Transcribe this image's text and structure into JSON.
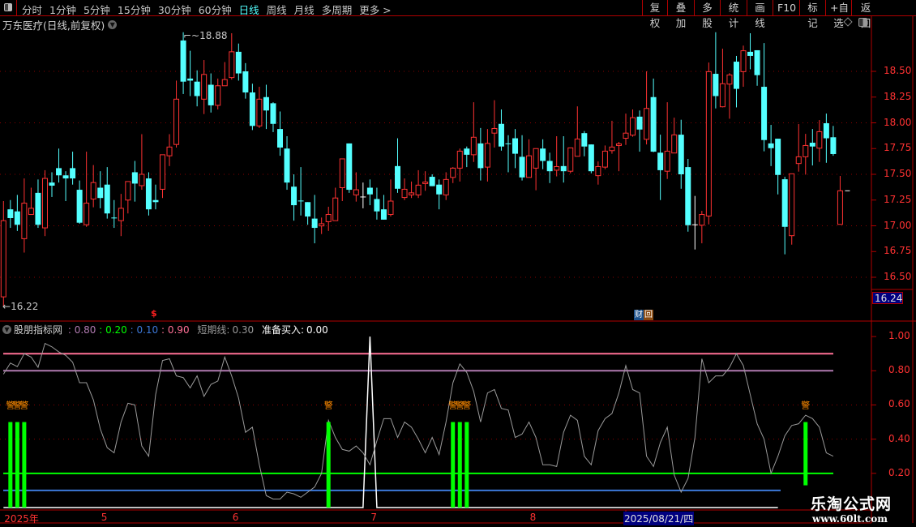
{
  "toolbar": {
    "periods": [
      "分时",
      "1分钟",
      "5分钟",
      "15分钟",
      "30分钟",
      "60分钟",
      "日线",
      "周线",
      "月线",
      "多周期",
      "更多 >"
    ],
    "active_period": "日线",
    "right_buttons": [
      "复权",
      "叠加",
      "多股",
      "统计",
      "画线",
      "F10",
      "标记",
      "+自选",
      "返回"
    ]
  },
  "chart_title": "万东医疗(日线,前复权)",
  "price_axis": [
    "18.50",
    "18.25",
    "18.00",
    "17.75",
    "17.50",
    "17.25",
    "17.00",
    "16.75",
    "16.50"
  ],
  "current_price_badge": "16.24",
  "high_label": "18.88",
  "low_label": "16.22",
  "markers": {
    "dollar": "$",
    "cai": "财",
    "hui": "回"
  },
  "indicator": {
    "name": "股朋指标网",
    "params": [
      {
        "sep": " : ",
        "value": "0.80",
        "color": "#b07ab0"
      },
      {
        "sep": " : ",
        "value": "0.20",
        "color": "#00ff00"
      },
      {
        "sep": " : ",
        "value": "0.10",
        "color": "#3c78d8"
      },
      {
        "sep": " : ",
        "value": "0.90",
        "color": "#ff7096"
      }
    ],
    "short_line_label": "短期线:",
    "short_line_value": "0.30",
    "buy_label": "准备买入:",
    "buy_value": "0.00",
    "axis": [
      "1.00",
      "0.80",
      "0.60",
      "0.40",
      "0.20"
    ],
    "signal_char": "警"
  },
  "time_axis": {
    "labels": [
      "2025年",
      "5",
      "6",
      "7",
      "8"
    ],
    "cursor_date": "2025/08/21/四"
  },
  "watermark": {
    "title": "乐淘公式网",
    "url": "www.60lt.com"
  },
  "colors": {
    "up": "#ff3232",
    "down": "#54ffff",
    "flat": "#ffffff",
    "accent": "#b00000"
  },
  "chart_data": {
    "type": "candlestick",
    "price_range": [
      16.22,
      18.88
    ],
    "ohlc": [
      [
        16.31,
        17.24,
        16.22,
        17.05
      ],
      [
        17.16,
        17.25,
        16.98,
        17.075
      ],
      [
        17.14,
        17.3,
        16.95,
        17.01
      ],
      [
        16.875,
        17.46,
        16.74,
        17.22
      ],
      [
        17.11,
        17.37,
        17.11,
        17.17
      ],
      [
        17.32,
        17.45,
        16.98,
        17.01
      ],
      [
        16.98,
        17.54,
        16.9,
        17.46
      ],
      [
        17.42,
        17.52,
        17.28,
        17.39
      ],
      [
        17.56,
        17.75,
        17.42,
        17.49
      ],
      [
        17.49,
        17.53,
        17.24,
        17.46
      ],
      [
        17.56,
        17.72,
        17.4,
        17.46
      ],
      [
        17.35,
        17.44,
        17.02,
        17.03
      ],
      [
        17.01,
        17.72,
        16.99,
        17.22
      ],
      [
        17.26,
        17.59,
        17.18,
        17.42
      ],
      [
        17.37,
        17.53,
        17.17,
        17.27
      ],
      [
        17.4,
        17.57,
        17.07,
        17.12
      ],
      [
        17.08,
        17.25,
        16.98,
        17.079
      ],
      [
        17.05,
        17.31,
        16.9,
        17.17
      ],
      [
        17.25,
        17.43,
        17.12,
        17.43
      ],
      [
        17.52,
        17.63,
        17.235,
        17.41
      ],
      [
        17.39,
        17.89,
        17.35,
        17.5
      ],
      [
        17.46,
        17.52,
        17.1,
        17.16
      ],
      [
        17.25,
        17.4,
        17.16,
        17.23
      ],
      [
        17.355,
        17.69,
        17.27,
        17.69
      ],
      [
        17.68,
        17.89,
        17.58,
        17.765
      ],
      [
        17.79,
        18.41,
        17.76,
        18.23
      ],
      [
        18.8,
        18.88,
        18.28,
        18.4
      ],
      [
        18.43,
        18.7,
        18.26,
        18.41
      ],
      [
        18.4,
        18.51,
        18.16,
        18.26
      ],
      [
        18.23,
        18.61,
        18.085,
        18.47
      ],
      [
        18.37,
        18.48,
        18.1,
        18.17
      ],
      [
        18.17,
        18.43,
        18.13,
        18.36
      ],
      [
        18.36,
        18.59,
        18.36,
        18.42
      ],
      [
        18.44,
        18.87,
        18.42,
        18.69
      ],
      [
        18.69,
        18.77,
        18.41,
        18.48
      ],
      [
        18.5,
        18.58,
        18.235,
        18.295
      ],
      [
        18.295,
        18.38,
        17.93,
        17.97
      ],
      [
        17.97,
        18.35,
        17.95,
        18.23
      ],
      [
        18.25,
        18.37,
        17.94,
        18.12
      ],
      [
        18.19,
        18.2,
        17.91,
        17.99
      ],
      [
        17.94,
        18.11,
        17.68,
        17.76
      ],
      [
        17.75,
        17.87,
        17.35,
        17.42
      ],
      [
        17.38,
        17.5,
        17.05,
        17.2
      ],
      [
        17.245,
        17.57,
        17.1,
        17.24
      ],
      [
        17.23,
        17.23,
        17.01,
        17.09
      ],
      [
        17.07,
        17.3,
        16.83,
        16.98
      ],
      [
        16.999,
        17.08,
        16.92,
        17.02
      ],
      [
        17.04,
        17.185,
        16.95,
        17.11
      ],
      [
        17.05,
        17.37,
        17.05,
        17.27
      ],
      [
        17.37,
        17.65,
        17.24,
        17.65
      ],
      [
        17.8,
        17.8,
        17.32,
        17.35
      ],
      [
        17.3,
        17.52,
        17.235,
        17.35
      ],
      [
        17.28,
        17.42,
        17.17,
        17.28
      ],
      [
        17.37,
        17.45,
        17.2,
        17.305
      ],
      [
        17.26,
        17.37,
        17.06,
        17.14
      ],
      [
        17.16,
        17.3,
        17.06,
        17.06
      ],
      [
        17.11,
        17.45,
        17.09,
        17.24
      ],
      [
        17.58,
        17.85,
        17.32,
        17.36
      ],
      [
        17.275,
        17.46,
        17.25,
        17.355
      ],
      [
        17.3,
        17.43,
        17.27,
        17.32
      ],
      [
        17.3,
        17.54,
        17.27,
        17.395
      ],
      [
        17.41,
        17.53,
        17.34,
        17.425
      ],
      [
        17.476,
        17.5,
        17.385,
        17.385
      ],
      [
        17.4,
        17.45,
        17.16,
        17.305
      ],
      [
        17.3,
        17.52,
        17.25,
        17.45
      ],
      [
        17.47,
        17.57,
        17.415,
        17.56
      ],
      [
        17.56,
        17.75,
        17.43,
        17.725
      ],
      [
        17.75,
        17.77,
        17.57,
        17.69
      ],
      [
        17.69,
        18.2,
        17.62,
        17.86
      ],
      [
        17.8,
        17.95,
        17.44,
        17.56
      ],
      [
        17.57,
        17.94,
        17.43,
        17.8
      ],
      [
        17.9,
        18.22,
        17.76,
        17.945
      ],
      [
        17.99,
        18.13,
        17.73,
        17.77
      ],
      [
        17.8,
        17.88,
        17.52,
        17.799
      ],
      [
        17.85,
        17.94,
        17.56,
        17.7
      ],
      [
        17.67,
        17.88,
        17.44,
        17.47
      ],
      [
        17.47,
        17.84,
        17.47,
        17.68
      ],
      [
        17.56,
        17.75,
        17.345,
        17.75
      ],
      [
        17.75,
        17.84,
        17.55,
        17.63
      ],
      [
        17.63,
        17.71,
        17.415,
        17.53
      ],
      [
        17.54,
        17.87,
        17.48,
        17.575
      ],
      [
        17.58,
        17.87,
        17.42,
        17.53
      ],
      [
        17.53,
        17.757,
        17.51,
        17.757
      ],
      [
        17.675,
        18.16,
        17.675,
        17.843
      ],
      [
        17.9,
        17.92,
        17.675,
        17.77
      ],
      [
        17.79,
        17.79,
        17.51,
        17.53
      ],
      [
        17.487,
        17.625,
        17.4,
        17.575
      ],
      [
        17.57,
        17.78,
        17.55,
        17.725
      ],
      [
        17.73,
        18.02,
        17.7,
        17.765
      ],
      [
        17.78,
        17.815,
        17.53,
        17.796
      ],
      [
        17.85,
        18.09,
        17.785,
        17.9
      ],
      [
        17.88,
        18.13,
        17.865,
        18.05
      ],
      [
        18.06,
        18.12,
        17.72,
        17.935
      ],
      [
        17.84,
        18.5,
        17.79,
        18.14
      ],
      [
        18.25,
        18.43,
        17.715,
        17.72
      ],
      [
        17.71,
        17.885,
        17.25,
        17.54
      ],
      [
        17.53,
        18.2,
        17.455,
        17.725
      ],
      [
        17.707,
        18.05,
        17.707,
        17.883
      ],
      [
        17.885,
        18.03,
        17.36,
        17.5
      ],
      [
        17.57,
        17.65,
        16.943,
        17.006
      ],
      [
        17.01,
        17.29,
        16.77,
        17.01
      ],
      [
        17.006,
        17.145,
        16.83,
        17.11
      ],
      [
        17.095,
        18.586,
        17.014,
        18.497
      ],
      [
        18.476,
        18.88,
        18.14,
        18.26
      ],
      [
        18.156,
        18.72,
        18.15,
        18.38
      ],
      [
        18.376,
        18.483,
        18.04,
        18.465
      ],
      [
        18.594,
        18.65,
        18.15,
        18.33
      ],
      [
        18.497,
        18.75,
        18.35,
        18.7
      ],
      [
        18.69,
        18.87,
        18.52,
        18.65
      ],
      [
        18.705,
        18.705,
        18.36,
        18.463
      ],
      [
        18.35,
        18.775,
        17.723,
        17.833
      ],
      [
        17.8,
        17.98,
        17.58,
        17.754
      ],
      [
        17.846,
        17.846,
        17.305,
        17.494
      ],
      [
        17.452,
        17.476,
        16.723,
        16.99
      ],
      [
        16.904,
        17.505,
        16.817,
        17.505
      ],
      [
        17.605,
        17.988,
        17.526,
        17.67
      ],
      [
        17.67,
        17.893,
        17.497,
        17.78
      ],
      [
        17.807,
        17.94,
        17.586,
        17.77
      ],
      [
        17.754,
        18.027,
        17.62,
        17.914
      ],
      [
        17.996,
        18.09,
        17.612,
        17.85
      ],
      [
        17.86,
        17.97,
        17.68,
        17.697
      ],
      [
        17.014,
        17.484,
        17.014,
        17.34
      ]
    ],
    "last_price_tick": 17.34,
    "indicator_range": [
      0,
      1
    ],
    "indicator_levels": [
      {
        "value": 0.9,
        "color": "#ff7096"
      },
      {
        "value": 0.8,
        "color": "#b07ab0"
      },
      {
        "value": 0.2,
        "color": "#00ff00"
      },
      {
        "value": 0.1,
        "color": "#3c78d8"
      }
    ],
    "short_line": [
      0.78,
      0.845,
      0.824,
      0.9,
      0.88,
      0.82,
      0.96,
      0.94,
      0.91,
      0.89,
      0.85,
      0.73,
      0.73,
      0.63,
      0.46,
      0.35,
      0.32,
      0.5,
      0.61,
      0.6,
      0.36,
      0.3,
      0.66,
      0.86,
      0.87,
      0.77,
      0.76,
      0.7,
      0.77,
      0.65,
      0.72,
      0.74,
      0.88,
      0.77,
      0.64,
      0.44,
      0.47,
      0.25,
      0.07,
      0.05,
      0.05,
      0.09,
      0.08,
      0.06,
      0.09,
      0.12,
      0.2,
      0.51,
      0.41,
      0.34,
      0.33,
      0.36,
      0.32,
      0.25,
      0.39,
      0.52,
      0.52,
      0.41,
      0.5,
      0.47,
      0.4,
      0.32,
      0.41,
      0.31,
      0.5,
      0.73,
      0.84,
      0.79,
      0.68,
      0.5,
      0.67,
      0.69,
      0.58,
      0.57,
      0.41,
      0.43,
      0.5,
      0.41,
      0.25,
      0.25,
      0.24,
      0.44,
      0.54,
      0.51,
      0.3,
      0.25,
      0.45,
      0.52,
      0.55,
      0.67,
      0.83,
      0.69,
      0.67,
      0.3,
      0.24,
      0.38,
      0.47,
      0.19,
      0.09,
      0.17,
      0.41,
      0.87,
      0.73,
      0.77,
      0.77,
      0.82,
      0.9,
      0.83,
      0.66,
      0.49,
      0.4,
      0.2,
      0.3,
      0.42,
      0.48,
      0.49,
      0.54,
      0.52,
      0.47,
      0.32,
      0.3
    ],
    "buy_line_peaks": [
      {
        "index": 53,
        "value": 1.0
      }
    ],
    "buy_line_length": 113,
    "signal_bars": [
      {
        "index": 1,
        "from": 0,
        "to": 0.5
      },
      {
        "index": 2,
        "from": 0,
        "to": 0.5
      },
      {
        "index": 3,
        "from": 0,
        "to": 0.5
      },
      {
        "index": 47,
        "from": 0,
        "to": 0.5
      },
      {
        "index": 65,
        "from": 0,
        "to": 0.5
      },
      {
        "index": 66,
        "from": 0,
        "to": 0.5
      },
      {
        "index": 67,
        "from": 0,
        "to": 0.5
      },
      {
        "index": 116,
        "from": 0.13,
        "to": 0.5
      }
    ],
    "time_label_indices": [
      0,
      14,
      33,
      53,
      76
    ],
    "cursor_index": 90
  }
}
